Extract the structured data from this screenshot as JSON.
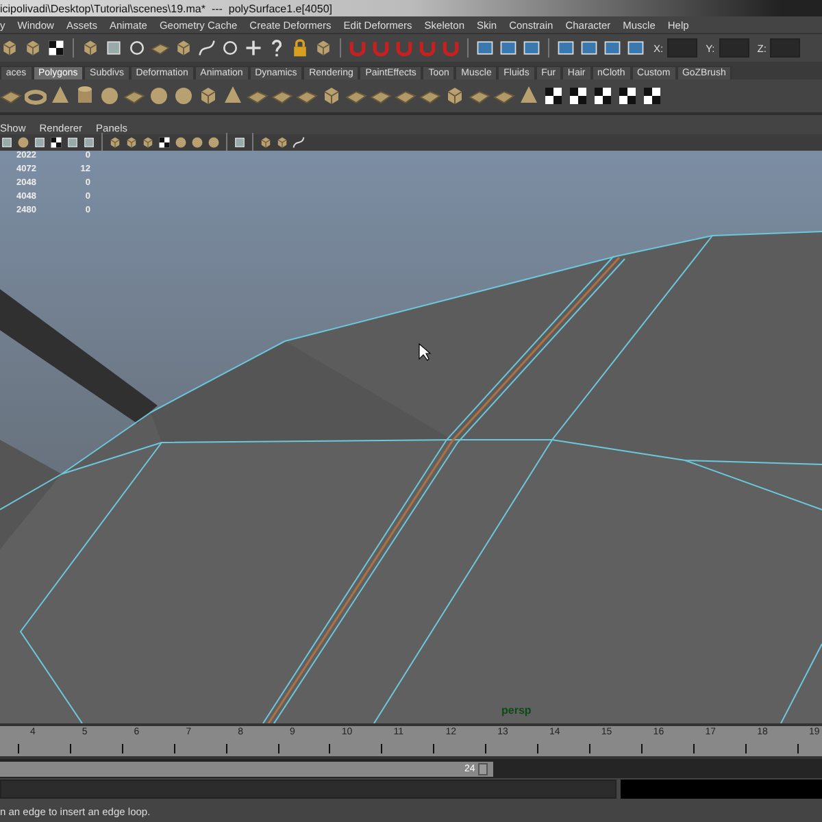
{
  "window": {
    "title": "icipolivadi\\Desktop\\Tutorial\\scenes\\19.ma*  ---  polySurface1.e[4050]"
  },
  "menu": [
    "y",
    "Window",
    "Assets",
    "Animate",
    "Geometry Cache",
    "Create Deformers",
    "Edit Deformers",
    "Skeleton",
    "Skin",
    "Constrain",
    "Character",
    "Muscle",
    "Help"
  ],
  "coordinate_fields": [
    {
      "label": "X:"
    },
    {
      "label": "Y:"
    },
    {
      "label": "Z:"
    }
  ],
  "shelf_tabs": [
    {
      "label": "aces",
      "selected": false
    },
    {
      "label": "Polygons",
      "selected": true
    },
    {
      "label": "Subdivs",
      "selected": false
    },
    {
      "label": "Deformation",
      "selected": false
    },
    {
      "label": "Animation",
      "selected": false
    },
    {
      "label": "Dynamics",
      "selected": false
    },
    {
      "label": "Rendering",
      "selected": false
    },
    {
      "label": "PaintEffects",
      "selected": false
    },
    {
      "label": "Toon",
      "selected": false
    },
    {
      "label": "Muscle",
      "selected": false
    },
    {
      "label": "Fluids",
      "selected": false
    },
    {
      "label": "Fur",
      "selected": false
    },
    {
      "label": "Hair",
      "selected": false
    },
    {
      "label": "nCloth",
      "selected": false
    },
    {
      "label": "Custom",
      "selected": false
    },
    {
      "label": "GoZBrush",
      "selected": false
    }
  ],
  "panel_menu": [
    "Show",
    "Renderer",
    "Panels"
  ],
  "hud_rows": [
    {
      "column_1": "2022",
      "column_2": "0"
    },
    {
      "column_1": "4072",
      "column_2": "12"
    },
    {
      "column_1": "2048",
      "column_2": "0"
    },
    {
      "column_1": "4048",
      "column_2": "0"
    },
    {
      "column_1": "2480",
      "column_2": "0"
    }
  ],
  "camera_label": "persp",
  "time_slider": {
    "ticks": [
      "4",
      "5",
      "6",
      "7",
      "8",
      "9",
      "10",
      "11",
      "12",
      "13",
      "14",
      "15",
      "16",
      "17",
      "18",
      "19"
    ]
  },
  "range_slider": {
    "end_frame": "24",
    "level": 0.6
  },
  "help_line": "n an edge to insert an edge loop."
}
